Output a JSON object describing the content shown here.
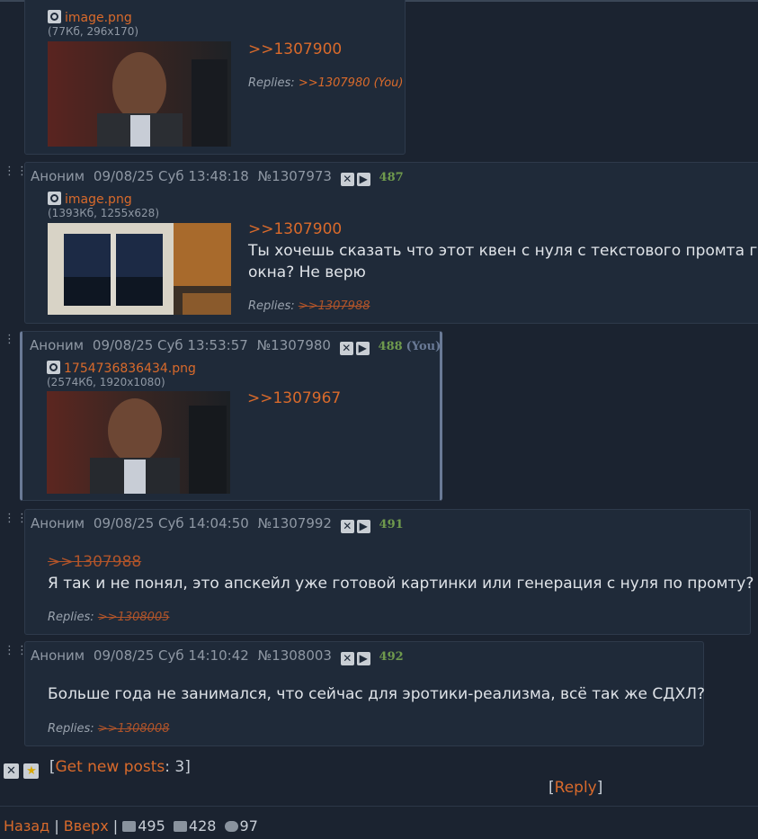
{
  "posts": [
    {
      "file": {
        "name": "image.png",
        "info": "(77Кб, 296x170)"
      },
      "quote": ">>1307900",
      "replies_label": "Replies:",
      "reply_link": ">>1307980 (You)"
    },
    {
      "author": "Аноним",
      "date": "09/08/25 Суб 13:48:18",
      "num": "№1307973",
      "count": "487",
      "file": {
        "name": "image.png",
        "info": "(1393Кб, 1255x628)"
      },
      "quote": ">>1307900",
      "text": "Ты хочешь сказать что этот квен с нуля с текстового промта гене окна? Не верю",
      "text_line1": "Ты хочешь сказать что этот квен с нуля с текстового промта гене",
      "text_line2": "окна? Не верю",
      "replies_label": "Replies:",
      "reply_link": ">>1307988"
    },
    {
      "author": "Аноним",
      "date": "09/08/25 Суб 13:53:57",
      "num": "№1307980",
      "count": "488",
      "you": "(You)",
      "file": {
        "name": "1754736836434.png",
        "info": "(2574Кб, 1920x1080)"
      },
      "quote": ">>1307967"
    },
    {
      "author": "Аноним",
      "date": "09/08/25 Суб 14:04:50",
      "num": "№1307992",
      "count": "491",
      "quote": ">>1307988",
      "text": "Я так и не понял, это апскейл уже готовой картинки или генерация с нуля по промту?",
      "replies_label": "Replies:",
      "reply_link": ">>1308005"
    },
    {
      "author": "Аноним",
      "date": "09/08/25 Суб 14:10:42",
      "num": "№1308003",
      "count": "492",
      "text": "Больше года не занимался, что сейчас для эротики-реализма, всё так же СДХЛ?",
      "replies_label": "Replies:",
      "reply_link": ">>1308008"
    }
  ],
  "thread_bar": {
    "get_new_posts": "Get new posts",
    "new_count": ": 3",
    "reply": "Reply"
  },
  "footer": {
    "back": "Назад",
    "up": "Вверх",
    "posts": "495",
    "images": "428",
    "posters": "97"
  },
  "colors": {
    "background": "#1b2330",
    "post": "#1f2a39",
    "link": "#d96a2b",
    "count": "#6f9a4d"
  }
}
